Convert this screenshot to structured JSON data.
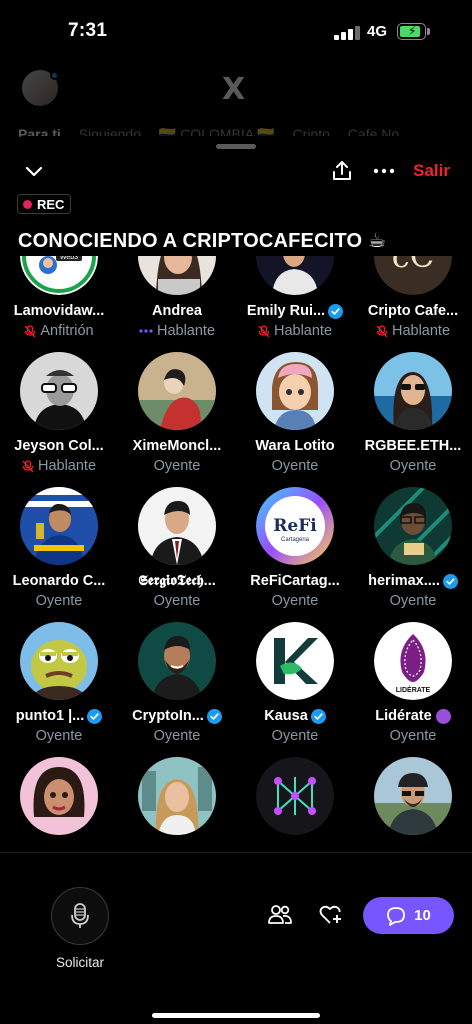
{
  "status": {
    "time": "7:31",
    "network": "4G",
    "battery_level": 0.85
  },
  "background": {
    "logo": "X",
    "tabs": [
      "Para ti",
      "Siguiendo",
      "🇨🇴 COLOMBIA 🇨🇴",
      "Cripto",
      "Cafe No"
    ]
  },
  "space": {
    "rec_label": "REC",
    "title": "CONOCIENDO A CRIPTOCAFECITO ☕",
    "leave_label": "Salir"
  },
  "participants": [
    {
      "name": "Lamovidaw...",
      "role": "Anfitrión",
      "role_icon": "mic-off",
      "verified": false,
      "avatar": "movida-logo"
    },
    {
      "name": "Andrea",
      "role": "Hablante",
      "role_icon": "speaking-dots",
      "verified": false,
      "avatar": "woman-photo"
    },
    {
      "name": "Emily Rui...",
      "role": "Hablante",
      "role_icon": "mic-off",
      "verified": true,
      "avatar": "woman-night"
    },
    {
      "name": "Cripto Cafe...",
      "role": "Hablante",
      "role_icon": "mic-off",
      "verified": false,
      "avatar": "cc-logo"
    },
    {
      "name": "Jeyson Col...",
      "role": "Hablante",
      "role_icon": "mic-off",
      "verified": false,
      "avatar": "bw-man"
    },
    {
      "name": "XimeMoncl...",
      "role": "Oyente",
      "role_icon": "",
      "verified": false,
      "avatar": "art-woman"
    },
    {
      "name": "Wara Lotito",
      "role": "Oyente",
      "role_icon": "",
      "verified": false,
      "avatar": "cartoon-girl"
    },
    {
      "name": "RGBEE.ETH...",
      "role": "Oyente",
      "role_icon": "",
      "verified": false,
      "avatar": "woman-sunglasses"
    },
    {
      "name": "Leonardo C...",
      "role": "Oyente",
      "role_icon": "",
      "verified": false,
      "avatar": "soccer-man"
    },
    {
      "name": "𝕾𝖊𝖗𝖌𝖎𝖔𝕿𝖊𝖈𝖍...",
      "role": "Oyente",
      "role_icon": "",
      "verified": false,
      "avatar": "man-suit"
    },
    {
      "name": "ReFiCartag...",
      "role": "Oyente",
      "role_icon": "",
      "verified": false,
      "avatar": "refi-logo"
    },
    {
      "name": "herimax....",
      "role": "Oyente",
      "role_icon": "",
      "verified": true,
      "avatar": "green-avatar"
    },
    {
      "name": "punto1 |...",
      "role": "Oyente",
      "role_icon": "",
      "verified": true,
      "avatar": "frog"
    },
    {
      "name": "CryptoIn...",
      "role": "Oyente",
      "role_icon": "",
      "verified": true,
      "avatar": "bearded-man"
    },
    {
      "name": "Kausa",
      "role": "Oyente",
      "role_icon": "",
      "verified": true,
      "avatar": "kausa-logo"
    },
    {
      "name": "Lidérate",
      "role": "Oyente",
      "role_icon": "",
      "verified": false,
      "badge": "purple-circle",
      "avatar": "liderate-logo"
    },
    {
      "name": "",
      "role": "",
      "role_icon": "",
      "verified": false,
      "avatar": "3d-girl"
    },
    {
      "name": "",
      "role": "",
      "role_icon": "",
      "verified": false,
      "avatar": "woman-city"
    },
    {
      "name": "",
      "role": "",
      "role_icon": "",
      "verified": false,
      "avatar": "network-logo"
    },
    {
      "name": "",
      "role": "",
      "role_icon": "",
      "verified": false,
      "avatar": "man-cap"
    }
  ],
  "bottom": {
    "mic_label": "Solicitar",
    "comments_count": "10"
  },
  "colors": {
    "accent": "#7856ff",
    "danger": "#f4212e",
    "verified": "#1d9bf0",
    "muted": "#8b98a5"
  }
}
